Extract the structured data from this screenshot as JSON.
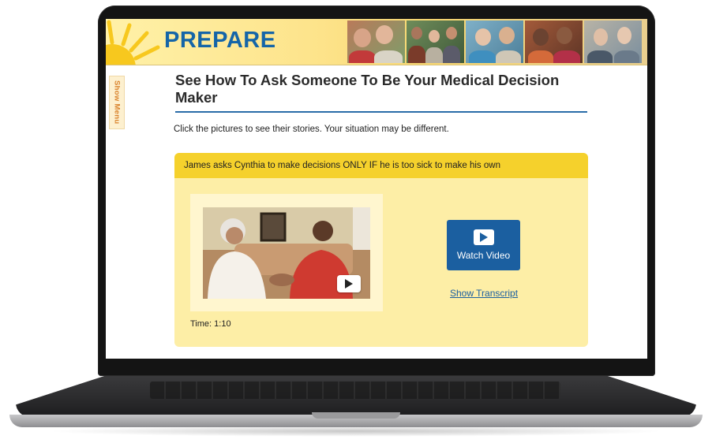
{
  "header": {
    "logo": "PREPARE"
  },
  "side_menu": {
    "label": "Show Menu"
  },
  "page": {
    "title": "See How To Ask Someone To Be Your Medical Decision Maker",
    "instructions": "Click the pictures to see their stories. Your situation may be different."
  },
  "story_card": {
    "heading": "James asks Cynthia to make decisions ONLY IF he is too sick to make his own",
    "time": "Time: 1:10",
    "watch_label": "Watch Video",
    "transcript_label": "Show Transcript"
  },
  "colors": {
    "brand_blue": "#1b5fa0",
    "card_header": "#f5d12c",
    "card_body": "#fdeea6",
    "accent_orange": "#d9822b"
  },
  "icons": [
    "sun-logo-icon",
    "play-icon",
    "video-play-icon"
  ]
}
